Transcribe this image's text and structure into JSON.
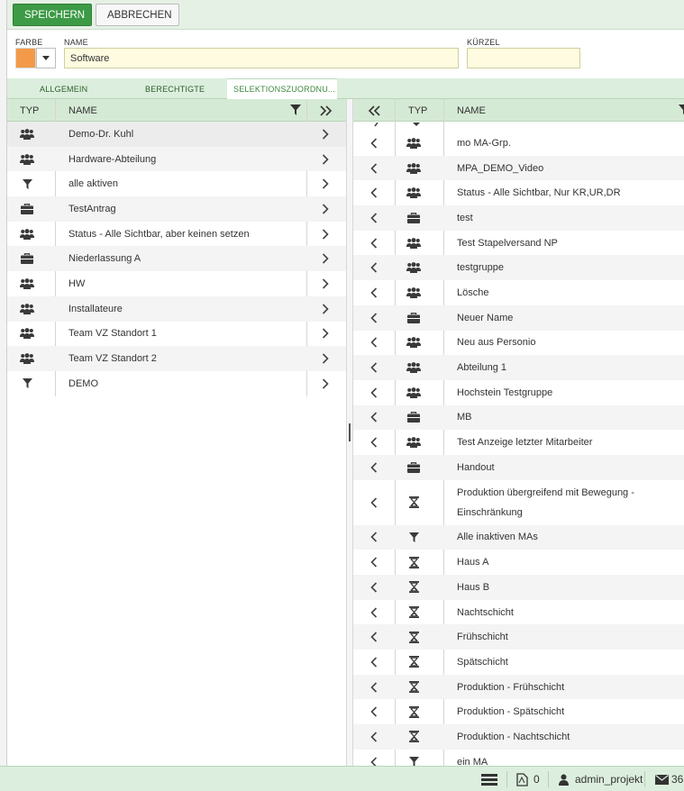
{
  "toolbar": {
    "save_label": "SPEICHERN",
    "cancel_label": "ABBRECHEN"
  },
  "form": {
    "color_label": "FARBE",
    "color_value": "#f39a4a",
    "name_label": "NAME",
    "name_value": "Software",
    "short_label": "KÜRZEL",
    "short_value": ""
  },
  "tabs": [
    {
      "label": "ALLGEMEIN"
    },
    {
      "label": "BERECHTIGTE"
    },
    {
      "label": "SELEKTIONSZUORDNU..."
    }
  ],
  "left": {
    "col_type": "TYP",
    "col_name": "NAME",
    "rows": [
      {
        "type": "group-icon",
        "name": "Demo-Dr. Kuhl"
      },
      {
        "type": "group-icon",
        "name": "Hardware-Abteilung"
      },
      {
        "type": "filter-icon",
        "name": "alle aktiven"
      },
      {
        "type": "briefcase-icon",
        "name": "TestAntrag"
      },
      {
        "type": "group-icon",
        "name": "Status - Alle Sichtbar, aber keinen setzen"
      },
      {
        "type": "briefcase-icon",
        "name": "Niederlassung A"
      },
      {
        "type": "group-icon",
        "name": "HW"
      },
      {
        "type": "group-icon",
        "name": "Installateure"
      },
      {
        "type": "group-icon",
        "name": "Team VZ Standort 1"
      },
      {
        "type": "group-icon",
        "name": "Team VZ Standort 2"
      },
      {
        "type": "filter-icon",
        "name": "DEMO"
      }
    ]
  },
  "right": {
    "col_type": "TYP",
    "col_name": "NAME",
    "rows": [
      {
        "type": "group-icon",
        "name": "mo MA-Grp."
      },
      {
        "type": "group-icon",
        "name": "MPA_DEMO_Video"
      },
      {
        "type": "group-icon",
        "name": "Status - Alle Sichtbar, Nur KR,UR,DR"
      },
      {
        "type": "briefcase-icon",
        "name": "test"
      },
      {
        "type": "group-icon",
        "name": "Test Stapelversand NP"
      },
      {
        "type": "group-icon",
        "name": "testgruppe"
      },
      {
        "type": "group-icon",
        "name": "Lösche"
      },
      {
        "type": "briefcase-icon",
        "name": "Neuer Name"
      },
      {
        "type": "group-icon",
        "name": "Neu aus Personio"
      },
      {
        "type": "group-icon",
        "name": "Abteilung 1"
      },
      {
        "type": "group-icon",
        "name": "Hochstein Testgruppe"
      },
      {
        "type": "briefcase-icon",
        "name": "MB"
      },
      {
        "type": "group-icon",
        "name": "Test Anzeige letzter Mitarbeiter"
      },
      {
        "type": "briefcase-icon",
        "name": "Handout"
      },
      {
        "type": "hourglass-icon",
        "name": "Produktion übergreifend mit Bewegung - Einschränkung",
        "tall": true
      },
      {
        "type": "filter-icon",
        "name": "Alle inaktiven MAs"
      },
      {
        "type": "hourglass-icon",
        "name": "Haus A"
      },
      {
        "type": "hourglass-icon",
        "name": "Haus B"
      },
      {
        "type": "hourglass-icon",
        "name": "Nachtschicht"
      },
      {
        "type": "hourglass-icon",
        "name": "Frühschicht"
      },
      {
        "type": "hourglass-icon",
        "name": "Spätschicht"
      },
      {
        "type": "hourglass-icon",
        "name": "Produktion - Frühschicht"
      },
      {
        "type": "hourglass-icon",
        "name": "Produktion - Spätschicht"
      },
      {
        "type": "hourglass-icon",
        "name": "Produktion - Nachtschicht"
      },
      {
        "type": "filter-icon",
        "name": "ein MA"
      }
    ]
  },
  "statusbar": {
    "pdf_count": "0",
    "user": "admin_projekt",
    "mail_count": "36"
  }
}
